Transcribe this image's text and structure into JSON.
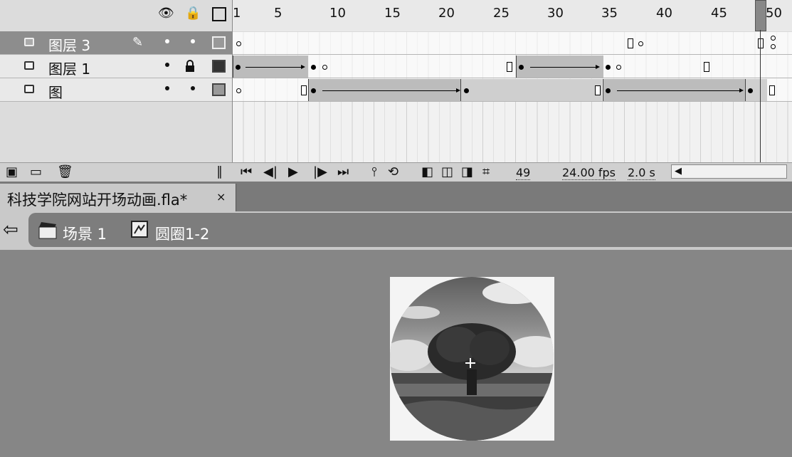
{
  "timeline": {
    "header_icons": [
      "eye-icon",
      "lock-icon",
      "outline-icon"
    ],
    "ruler_labels": [
      "1",
      "5",
      "10",
      "15",
      "20",
      "25",
      "30",
      "35",
      "40",
      "45",
      "50"
    ],
    "layers": [
      {
        "name": "图层 3",
        "selected": true
      },
      {
        "name": "图层 1",
        "selected": false
      },
      {
        "name": "图",
        "selected": false
      }
    ],
    "current_frame": "49",
    "fps": "24.00 fps",
    "time": "2.0 s"
  },
  "document_tab": {
    "title": "科技学院网站开场动画.fla*",
    "close": "×"
  },
  "breadcrumb": {
    "scene": "场景 1",
    "symbol": "圆圈1-2"
  },
  "colors": {
    "tween": "#bcbcbc",
    "selected_layer": "#8d8d8d",
    "stage": "#868686"
  }
}
